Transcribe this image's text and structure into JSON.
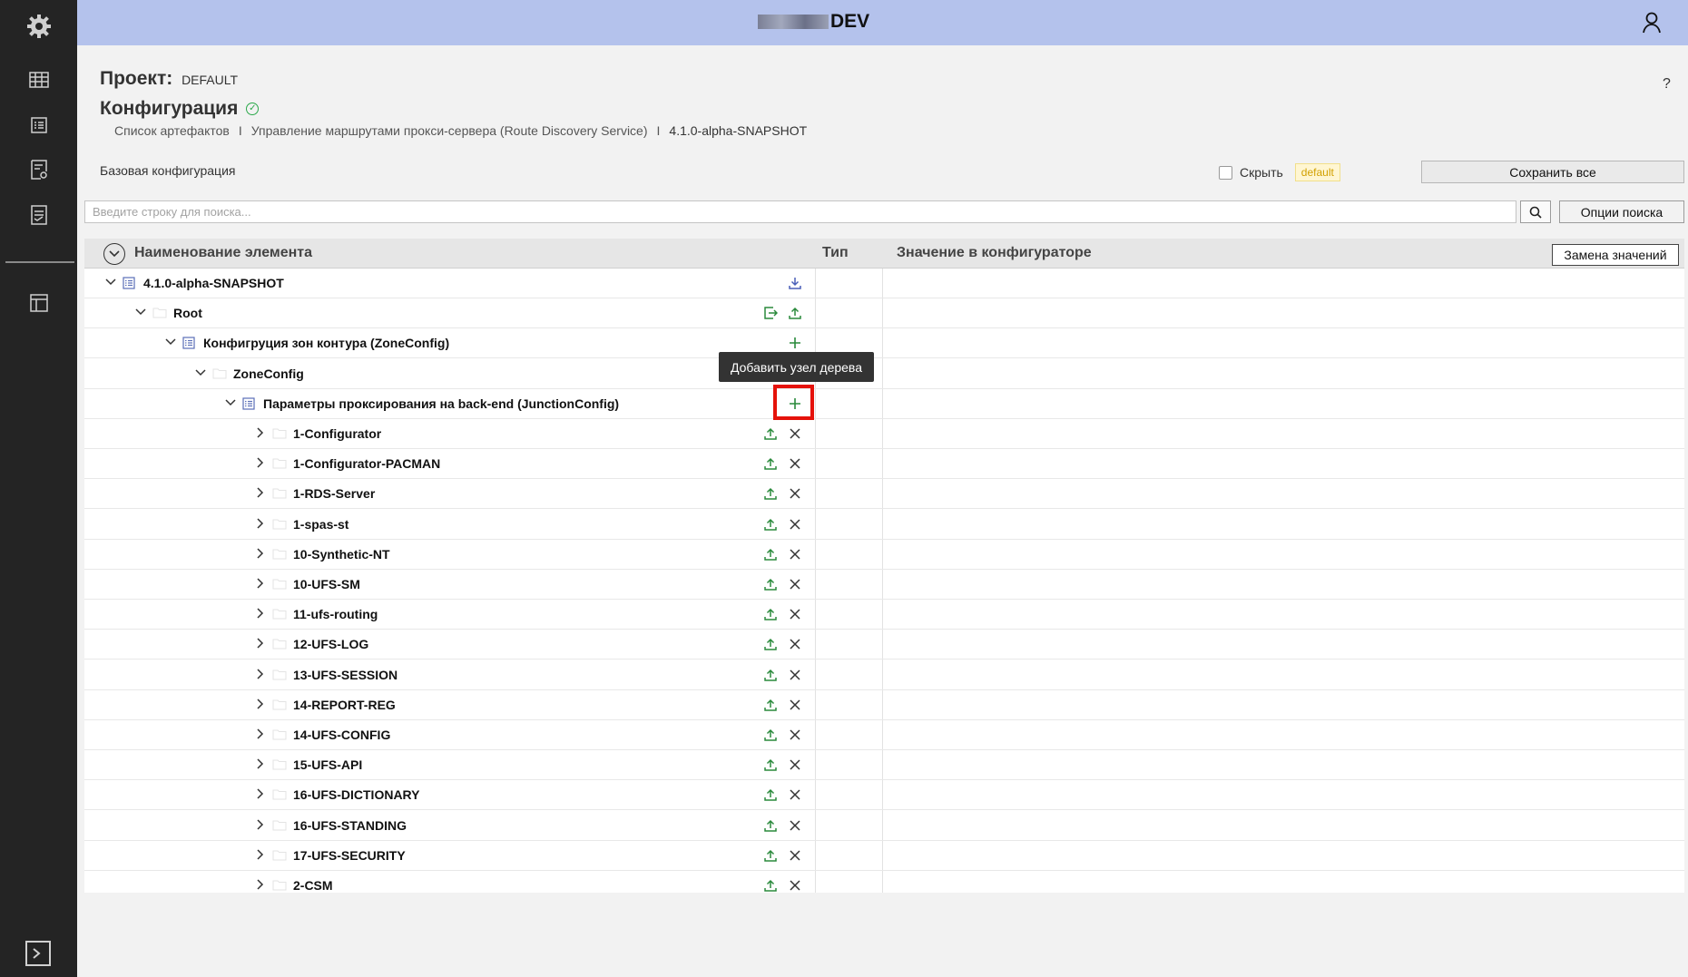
{
  "header": {
    "env_label": "DEV"
  },
  "sidebar": {
    "items": [
      {
        "icon": "gear-icon"
      },
      {
        "icon": "table-icon"
      },
      {
        "icon": "list-icon"
      },
      {
        "icon": "document-settings-icon"
      },
      {
        "icon": "document-list-icon"
      },
      {
        "icon": "layout-icon"
      }
    ],
    "bottom_icon": "terminal-icon"
  },
  "page": {
    "project_label": "Проект:",
    "project_value": "DEFAULT",
    "title": "Конфигурация",
    "help": "?",
    "breadcrumbs": [
      "Список артефактов",
      "Управление маршрутами прокси-сервера (Route Discovery Service)",
      "4.1.0-alpha-SNAPSHOT"
    ],
    "crumb_sep": "I",
    "base_config_label": "Базовая конфигурация",
    "hide_label": "Скрыть",
    "hide_badge": "default",
    "save_all_label": "Сохранить все",
    "search_placeholder": "Введите строку для поиска...",
    "search_options_label": "Опции поиска"
  },
  "table": {
    "columns": {
      "name": "Наименование элемента",
      "type": "Тип",
      "value": "Значение в конфигураторе"
    },
    "replace_label": "Замена значений",
    "tooltip": "Добавить узел дерева",
    "rows": [
      {
        "label": "4.1.0-alpha-SNAPSHOT",
        "icon": "document-icon"
      },
      {
        "label": "Root",
        "icon": "folder-icon"
      },
      {
        "label": "Конфигруция зон контура (ZoneConfig)",
        "icon": "document-icon"
      },
      {
        "label": "ZoneConfig",
        "icon": "folder-icon"
      },
      {
        "label": "Параметры проксирования на back-end (JunctionConfig)",
        "icon": "document-icon"
      },
      {
        "label": "1-Configurator"
      },
      {
        "label": "1-Configurator-PACMAN"
      },
      {
        "label": "1-RDS-Server"
      },
      {
        "label": "1-spas-st"
      },
      {
        "label": "10-Synthetic-NT"
      },
      {
        "label": "10-UFS-SM"
      },
      {
        "label": "11-ufs-routing"
      },
      {
        "label": "12-UFS-LOG"
      },
      {
        "label": "13-UFS-SESSION"
      },
      {
        "label": "14-REPORT-REG"
      },
      {
        "label": "14-UFS-CONFIG"
      },
      {
        "label": "15-UFS-API"
      },
      {
        "label": "16-UFS-DICTIONARY"
      },
      {
        "label": "16-UFS-STANDING"
      },
      {
        "label": "17-UFS-SECURITY"
      },
      {
        "label": "2-CSM"
      }
    ]
  },
  "colors": {
    "header_bg": "#b4c2ec",
    "sidebar_bg": "#242424",
    "action_green": "#2a8a3c",
    "highlight_red": "#e5120a"
  }
}
